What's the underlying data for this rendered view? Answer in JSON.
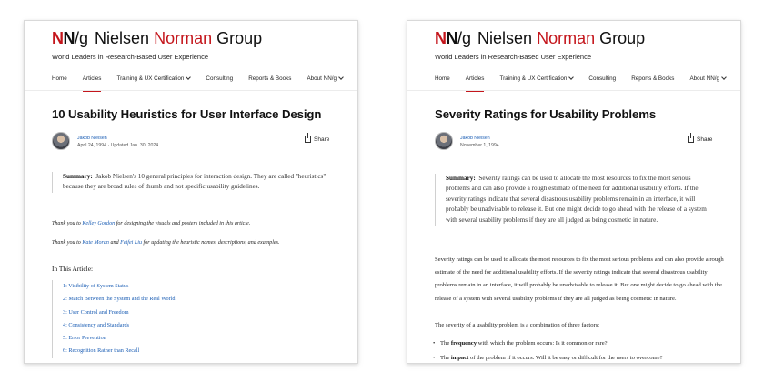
{
  "site": {
    "logo_nn_n1": "N",
    "logo_nn_n2": "N",
    "logo_slash": "/g",
    "logo_word1": "Nielsen",
    "logo_word2": "Norman",
    "logo_word3": "Group",
    "tagline": "World Leaders in Research-Based User Experience",
    "nav": {
      "home": "Home",
      "articles": "Articles",
      "training": "Training & UX Certification",
      "consulting": "Consulting",
      "reports": "Reports & Books",
      "about": "About NN/g"
    },
    "share_label": "Share"
  },
  "left": {
    "title": "10 Usability Heuristics for User Interface Design",
    "author": "Jakob Nielsen",
    "date": "April 24, 1994 · Updated Jan. 30, 2024",
    "summary_label": "Summary:",
    "summary_line1": "Jakob Nielsen's 10 general principles for interaction design. They are",
    "summary_line2": "called \"heuristics\" because they are broad rules of thumb and not specific usability",
    "summary_line3": "guidelines.",
    "thanks1_pre": "Thank you to ",
    "thanks1_link": "Kelley Gordon",
    "thanks1_post": " for designing the visuals and posters included in this article.",
    "thanks2_pre": "Thank you to ",
    "thanks2_link1": "Kate Moran",
    "thanks2_mid": " and ",
    "thanks2_link2": "Feifei Liu",
    "thanks2_post": " for updating the heuristic names, descriptions, and examples.",
    "toc_heading": "In This Article:",
    "toc": [
      "1: Visibility of System Status",
      "2: Match Between the System and the Real World",
      "3: User Control and Freedom",
      "4: Consistency and Standards",
      "5: Error Prevention",
      "6: Recognition Rather than Recall"
    ]
  },
  "right": {
    "title": "Severity Ratings for Usability Problems",
    "author": "Jakob Nielsen",
    "date": "November 1, 1994",
    "summary_label": "Summary:",
    "summary_line1": "Severity ratings can be used to allocate the most resources to fix the most",
    "summary_line2": "serious problems and can also provide a rough estimate of the need for additional",
    "summary_line3": "usability efforts. If the severity ratings indicate that several disastrous usability",
    "summary_line4": "problems remain in an interface, it will probably be unadvisable to release it. But one",
    "summary_line5": "might decide to go ahead with the release of a system with several usability problems",
    "summary_line6": "if they are all judged as being cosmetic in nature.",
    "para1_line1": "Severity ratings can be used to allocate the most resources to fix the most serious problems and",
    "para1_line2": "can also provide a rough estimate of the need for additional usability efforts. If the severity",
    "para1_line3": "ratings indicate that several disastrous usability problems remain in an interface, it will probably",
    "para1_line4": "be unadvisable to release it. But one might decide to go ahead with the release of a system with",
    "para1_line5": "several usability problems if they are all judged as being cosmetic in nature.",
    "para2": "The severity of a usability problem is a combination of three factors:",
    "bullet1_pre": "The ",
    "bullet1_bold": "frequency",
    "bullet1_post": " with which the problem occurs: Is it common or rare?",
    "bullet2_pre": "The ",
    "bullet2_bold": "impact",
    "bullet2_post": " of the problem if it occurs: Will it be easy or difficult for the users to overcome?"
  },
  "colors": {
    "brand_red": "#c4161c",
    "link_blue": "#1a5db4"
  }
}
